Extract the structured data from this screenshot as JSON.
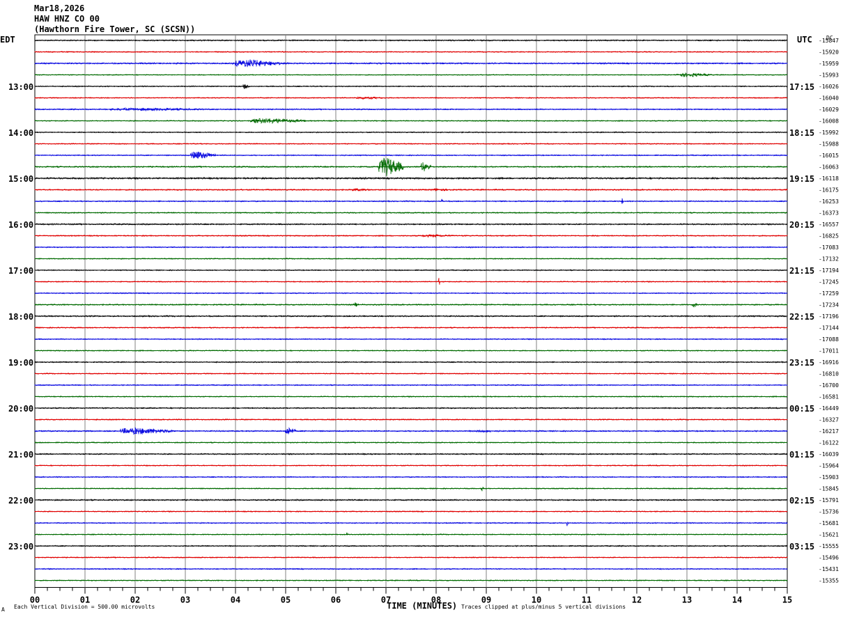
{
  "header": {
    "date": "Mar18,2026",
    "channel": "HAW HNZ CO 00",
    "station": "(Hawthorn Fire Tower, SC (SCSN))"
  },
  "left_zone": "EDT",
  "right_zone": "UTC",
  "dc_label": "DC",
  "footer": {
    "scale": "Each Vertical Division =  500.00 microvolts",
    "xlabel": "TIME (MINUTES)",
    "clip": "Traces clipped at plus/minus 5 vertical divisions",
    "mark": "A"
  },
  "colors": {
    "trace_cycle": [
      "#000000",
      "#e00000",
      "#0000e0",
      "#006a00"
    ],
    "grid": "#808080"
  },
  "chart_data": {
    "type": "line",
    "title": "",
    "xlabel": "TIME (MINUTES)",
    "xlim": [
      0,
      15
    ],
    "x_ticks": [
      "00",
      "01",
      "02",
      "03",
      "04",
      "05",
      "06",
      "07",
      "08",
      "09",
      "10",
      "11",
      "12",
      "13",
      "14",
      "15"
    ],
    "left_hour_labels": [
      {
        "trace": 4,
        "label": "13:00"
      },
      {
        "trace": 8,
        "label": "14:00"
      },
      {
        "trace": 12,
        "label": "15:00"
      },
      {
        "trace": 16,
        "label": "16:00"
      },
      {
        "trace": 20,
        "label": "17:00"
      },
      {
        "trace": 24,
        "label": "18:00"
      },
      {
        "trace": 28,
        "label": "19:00"
      },
      {
        "trace": 32,
        "label": "20:00"
      },
      {
        "trace": 36,
        "label": "21:00"
      },
      {
        "trace": 40,
        "label": "22:00"
      },
      {
        "trace": 44,
        "label": "23:00"
      }
    ],
    "right_hour_labels": [
      {
        "trace": 4,
        "label": "17:15"
      },
      {
        "trace": 8,
        "label": "18:15"
      },
      {
        "trace": 12,
        "label": "19:15"
      },
      {
        "trace": 16,
        "label": "20:15"
      },
      {
        "trace": 20,
        "label": "21:15"
      },
      {
        "trace": 24,
        "label": "22:15"
      },
      {
        "trace": 28,
        "label": "23:15"
      },
      {
        "trace": 32,
        "label": "00:15"
      },
      {
        "trace": 36,
        "label": "01:15"
      },
      {
        "trace": 40,
        "label": "02:15"
      },
      {
        "trace": 44,
        "label": "03:15"
      }
    ],
    "dc_offsets": [
      "-15847",
      "-15920",
      "-15959",
      "-15993",
      "-16026",
      "-16040",
      "-16029",
      "-16008",
      "-15992",
      "-15988",
      "-16015",
      "-16063",
      "-16118",
      "-16175",
      "-16253",
      "-16373",
      "-16557",
      "-16825",
      "-17083",
      "-17132",
      "-17194",
      "-17245",
      "-17259",
      "-17234",
      "-17196",
      "-17144",
      "-17088",
      "-17011",
      "-16916",
      "-16810",
      "-16700",
      "-16581",
      "-16449",
      "-16327",
      "-16217",
      "-16122",
      "-16039",
      "-15964",
      "-15903",
      "-15845",
      "-15791",
      "-15736",
      "-15681",
      "-15621",
      "-15555",
      "-15496",
      "-15431",
      "-15355"
    ],
    "noise_level": [
      1.2,
      1.0,
      1.3,
      0.9,
      1.0,
      1.0,
      1.1,
      1.0,
      1.0,
      1.0,
      1.0,
      1.3,
      1.6,
      1.2,
      1.1,
      1.1,
      1.3,
      1.1,
      1.0,
      1.0,
      1.0,
      1.0,
      1.0,
      1.2,
      1.3,
      1.1,
      1.0,
      1.0,
      1.1,
      1.0,
      1.0,
      1.0,
      1.2,
      1.1,
      1.2,
      1.0,
      1.2,
      1.0,
      1.0,
      1.0,
      1.3,
      1.0,
      1.0,
      1.0,
      1.1,
      1.0,
      1.0,
      1.0
    ],
    "events": [
      {
        "trace": 2,
        "start_min": 4.0,
        "end_min": 4.9,
        "amp": 6
      },
      {
        "trace": 3,
        "start_min": 12.8,
        "end_min": 13.5,
        "amp": 3
      },
      {
        "trace": 4,
        "start_min": 4.15,
        "end_min": 4.3,
        "amp": 4
      },
      {
        "trace": 5,
        "start_min": 6.4,
        "end_min": 7.0,
        "amp": 2
      },
      {
        "trace": 6,
        "start_min": 1.5,
        "end_min": 3.6,
        "amp": 2
      },
      {
        "trace": 7,
        "start_min": 4.3,
        "end_min": 5.4,
        "amp": 4
      },
      {
        "trace": 10,
        "start_min": 3.1,
        "end_min": 3.6,
        "amp": 6
      },
      {
        "trace": 11,
        "start_min": 6.85,
        "end_min": 7.35,
        "amp": 14
      },
      {
        "trace": 11,
        "start_min": 7.7,
        "end_min": 7.9,
        "amp": 8
      },
      {
        "trace": 13,
        "start_min": 6.3,
        "end_min": 6.8,
        "amp": 2
      },
      {
        "trace": 13,
        "start_min": 7.9,
        "end_min": 8.4,
        "amp": 2
      },
      {
        "trace": 14,
        "start_min": 8.1,
        "end_min": 8.13,
        "amp": 6
      },
      {
        "trace": 14,
        "start_min": 11.7,
        "end_min": 11.73,
        "amp": 6
      },
      {
        "trace": 17,
        "start_min": 7.7,
        "end_min": 8.4,
        "amp": 2
      },
      {
        "trace": 21,
        "start_min": 8.05,
        "end_min": 8.08,
        "amp": 8
      },
      {
        "trace": 23,
        "start_min": 6.35,
        "end_min": 6.45,
        "amp": 4
      },
      {
        "trace": 23,
        "start_min": 13.1,
        "end_min": 13.2,
        "amp": 4
      },
      {
        "trace": 34,
        "start_min": 1.7,
        "end_min": 2.8,
        "amp": 5
      },
      {
        "trace": 34,
        "start_min": 5.0,
        "end_min": 5.2,
        "amp": 6
      },
      {
        "trace": 34,
        "start_min": 8.8,
        "end_min": 9.3,
        "amp": 2
      },
      {
        "trace": 39,
        "start_min": 8.9,
        "end_min": 8.95,
        "amp": 4
      },
      {
        "trace": 42,
        "start_min": 10.6,
        "end_min": 10.63,
        "amp": 5
      },
      {
        "trace": 43,
        "start_min": 6.2,
        "end_min": 6.25,
        "amp": 4
      }
    ]
  }
}
